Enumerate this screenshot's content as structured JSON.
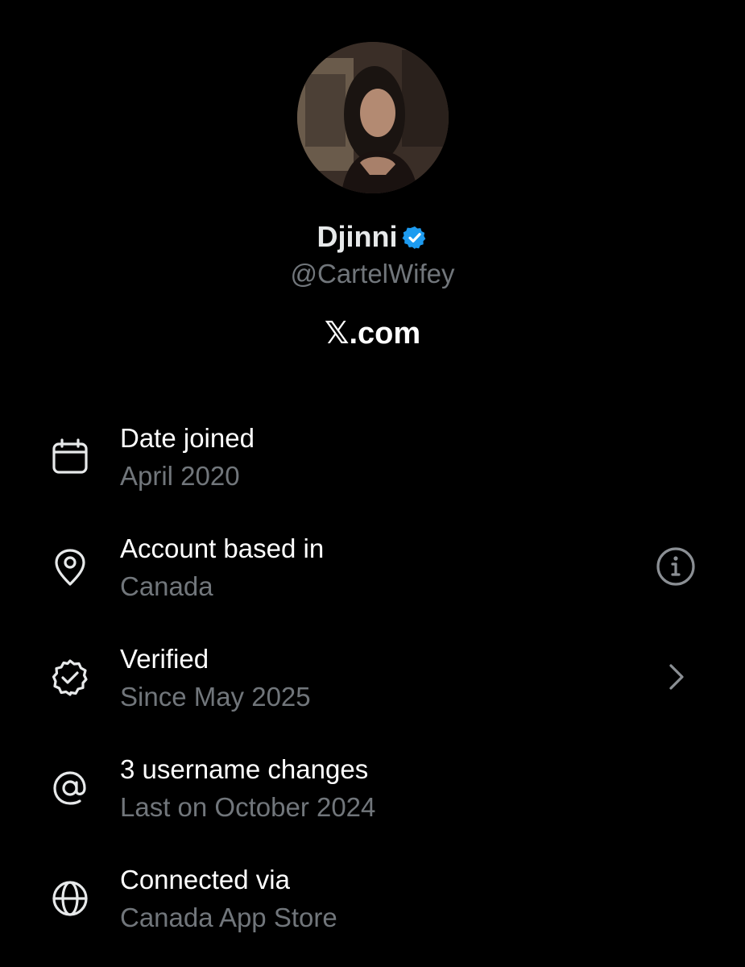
{
  "profile": {
    "display_name": "Djinni",
    "handle": "@CartelWifey",
    "platform": "𝕏.com",
    "verified_badge_color": "#1d9bf0"
  },
  "info_rows": [
    {
      "icon": "calendar-icon",
      "title": "Date joined",
      "value": "April 2020",
      "action": null
    },
    {
      "icon": "location-pin-icon",
      "title": "Account based in",
      "value": "Canada",
      "action": "info-icon"
    },
    {
      "icon": "verified-badge-outline-icon",
      "title": "Verified",
      "value": "Since May 2025",
      "action": "chevron-right-icon"
    },
    {
      "icon": "at-sign-icon",
      "title": "3 username changes",
      "value": "Last on October 2024",
      "action": null
    },
    {
      "icon": "globe-icon",
      "title": "Connected via",
      "value": "Canada App Store",
      "action": null
    }
  ],
  "colors": {
    "background": "#000000",
    "primary_text": "#e7e9ea",
    "secondary_text": "#71767b",
    "accent_blue": "#1d9bf0"
  }
}
